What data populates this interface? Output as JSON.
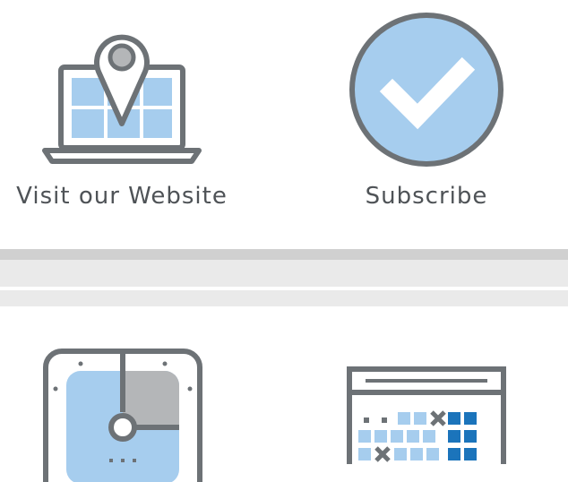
{
  "tiles": {
    "website": {
      "label": "Visit our Website",
      "icon": "laptop-location-pin-icon"
    },
    "subscribe": {
      "label": "Subscribe",
      "icon": "checkmark-circle-icon"
    },
    "clock": {
      "icon": "clock-icon"
    },
    "calendar": {
      "icon": "calendar-grid-icon"
    }
  },
  "colors": {
    "icon_stroke": "#6d7276",
    "icon_fill_light_blue": "#a6cdee",
    "icon_fill_gray": "#b4b6b8",
    "calendar_dark_blue": "#1b74bb",
    "label_text": "#4f5357"
  }
}
